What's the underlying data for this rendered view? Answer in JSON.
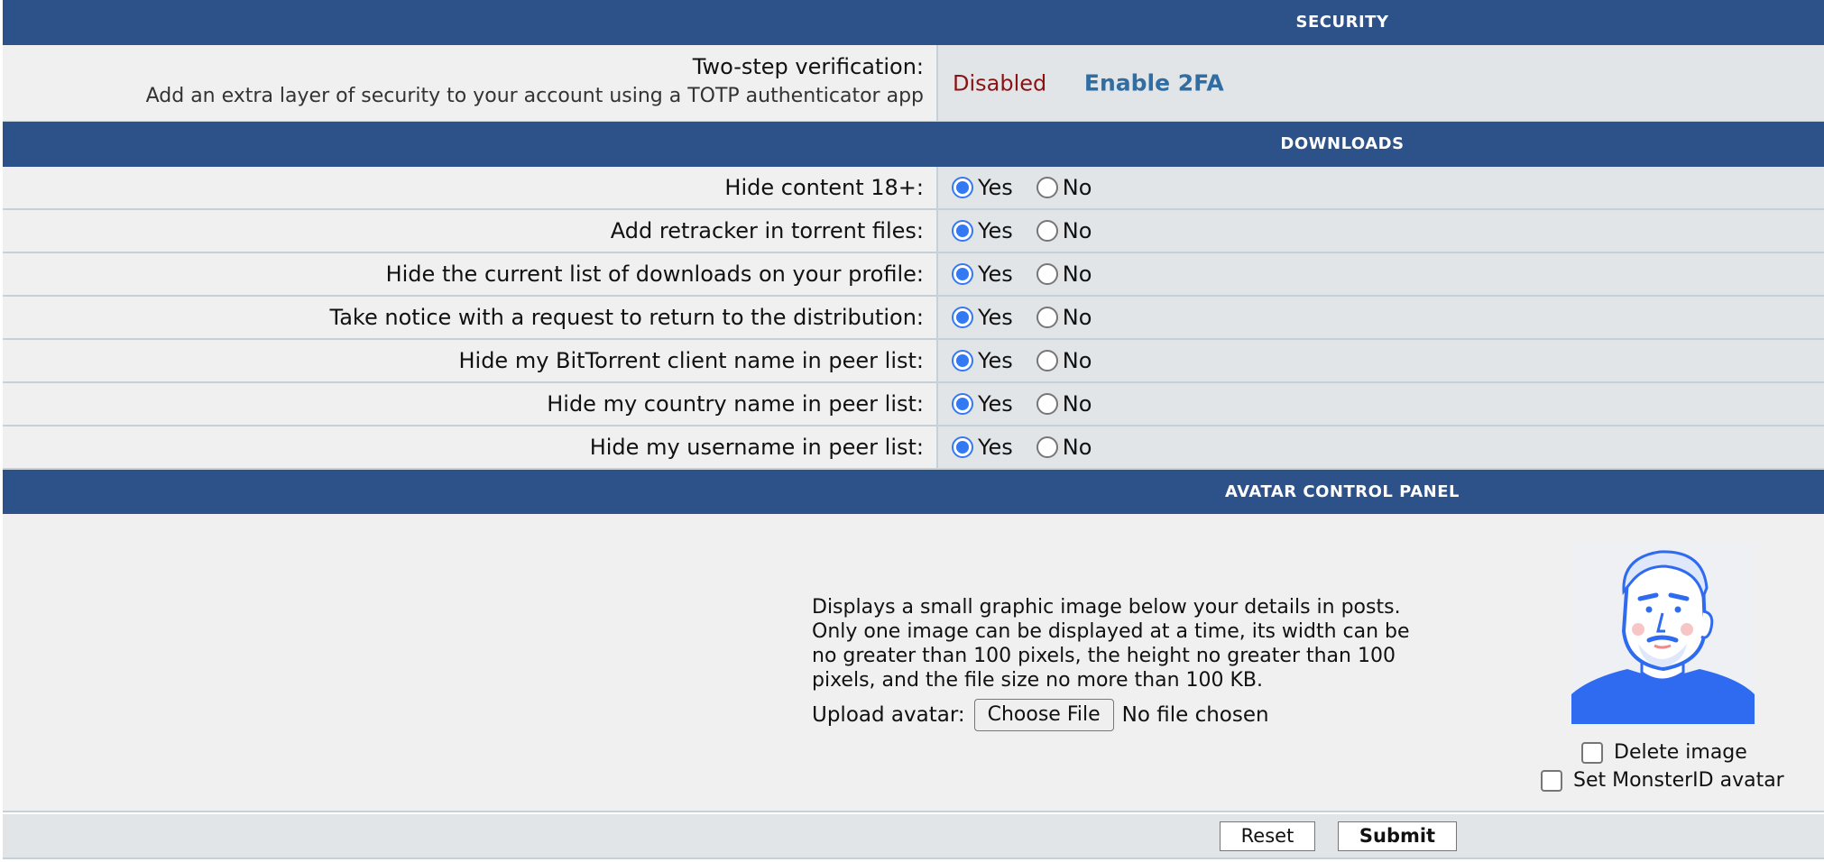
{
  "security": {
    "title": "SECURITY",
    "two_step_label": "Two-step verification:",
    "two_step_desc": "Add an extra layer of security to your account using a TOTP authenticator app",
    "status": "Disabled",
    "enable_link": "Enable 2FA"
  },
  "downloads": {
    "title": "DOWNLOADS",
    "yes_label": "Yes",
    "no_label": "No",
    "rows": [
      {
        "label": "Hide content 18+:",
        "selected": "yes"
      },
      {
        "label": "Add retracker in torrent files:",
        "selected": "yes"
      },
      {
        "label": "Hide the current list of downloads on your profile:",
        "selected": "yes"
      },
      {
        "label": "Take notice with a request to return to the distribution:",
        "selected": "yes"
      },
      {
        "label": "Hide my BitTorrent client name in peer list:",
        "selected": "yes"
      },
      {
        "label": "Hide my country name in peer list:",
        "selected": "yes"
      },
      {
        "label": "Hide my username in peer list:",
        "selected": "yes"
      }
    ]
  },
  "avatar": {
    "title": "AVATAR CONTROL PANEL",
    "description": "Displays a small graphic image below your details in posts. Only one image can be displayed at a time, its width can be no greater than 100 pixels, the height no greater than 100 pixels, and the file size no more than 100 KB.",
    "upload_label": "Upload avatar:",
    "choose_file": "Choose File",
    "no_file": "No file chosen",
    "delete_image": "Delete image",
    "set_monsterid": "Set MonsterID avatar"
  },
  "footer": {
    "reset": "Reset",
    "submit": "Submit"
  },
  "colors": {
    "header_bg": "#2c5289",
    "radio_accent": "#3479f4",
    "disabled_text": "#8a1212",
    "link": "#2f6da3"
  }
}
